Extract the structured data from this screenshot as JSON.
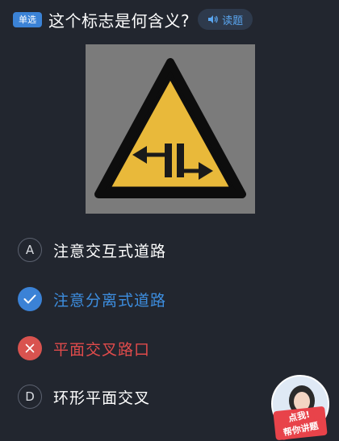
{
  "question": {
    "type_badge": "单选",
    "text": "这个标志是何含义?",
    "read_button_label": "读题"
  },
  "options": [
    {
      "letter": "A",
      "text": "注意交互式道路",
      "state": "normal"
    },
    {
      "letter": "B",
      "text": "注意分离式道路",
      "state": "correct"
    },
    {
      "letter": "C",
      "text": "平面交叉路口",
      "state": "wrong"
    },
    {
      "letter": "D",
      "text": "环形平面交叉",
      "state": "normal"
    }
  ],
  "helper": {
    "label_line1": "点我!",
    "label_line2": "帮你讲题"
  },
  "colors": {
    "background": "#22262f",
    "accent_blue": "#3b82d6",
    "error_red": "#d9534f",
    "sign_yellow": "#e9b93a"
  }
}
